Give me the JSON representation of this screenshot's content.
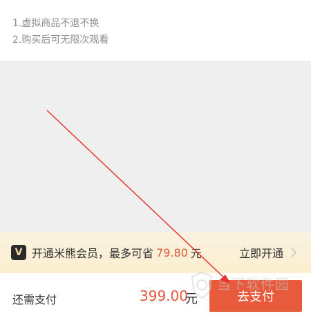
{
  "notes": [
    "1.虚拟商品不退不换",
    "2.购买后可无限次观看"
  ],
  "member_banner": {
    "badge": "V",
    "text": "开通米熊会员，最多可省",
    "amount": "79.80",
    "unit": "元",
    "action": "立即开通"
  },
  "payment": {
    "label": "还需支付",
    "amount": "399.00",
    "unit": "元",
    "button": "去支付"
  },
  "watermark": "当下软件园",
  "colors": {
    "accent": "#e85a3c",
    "price": "#e2573d",
    "banner_bg": "#fbf1dc",
    "annotation_arrow": "#e8352c"
  }
}
